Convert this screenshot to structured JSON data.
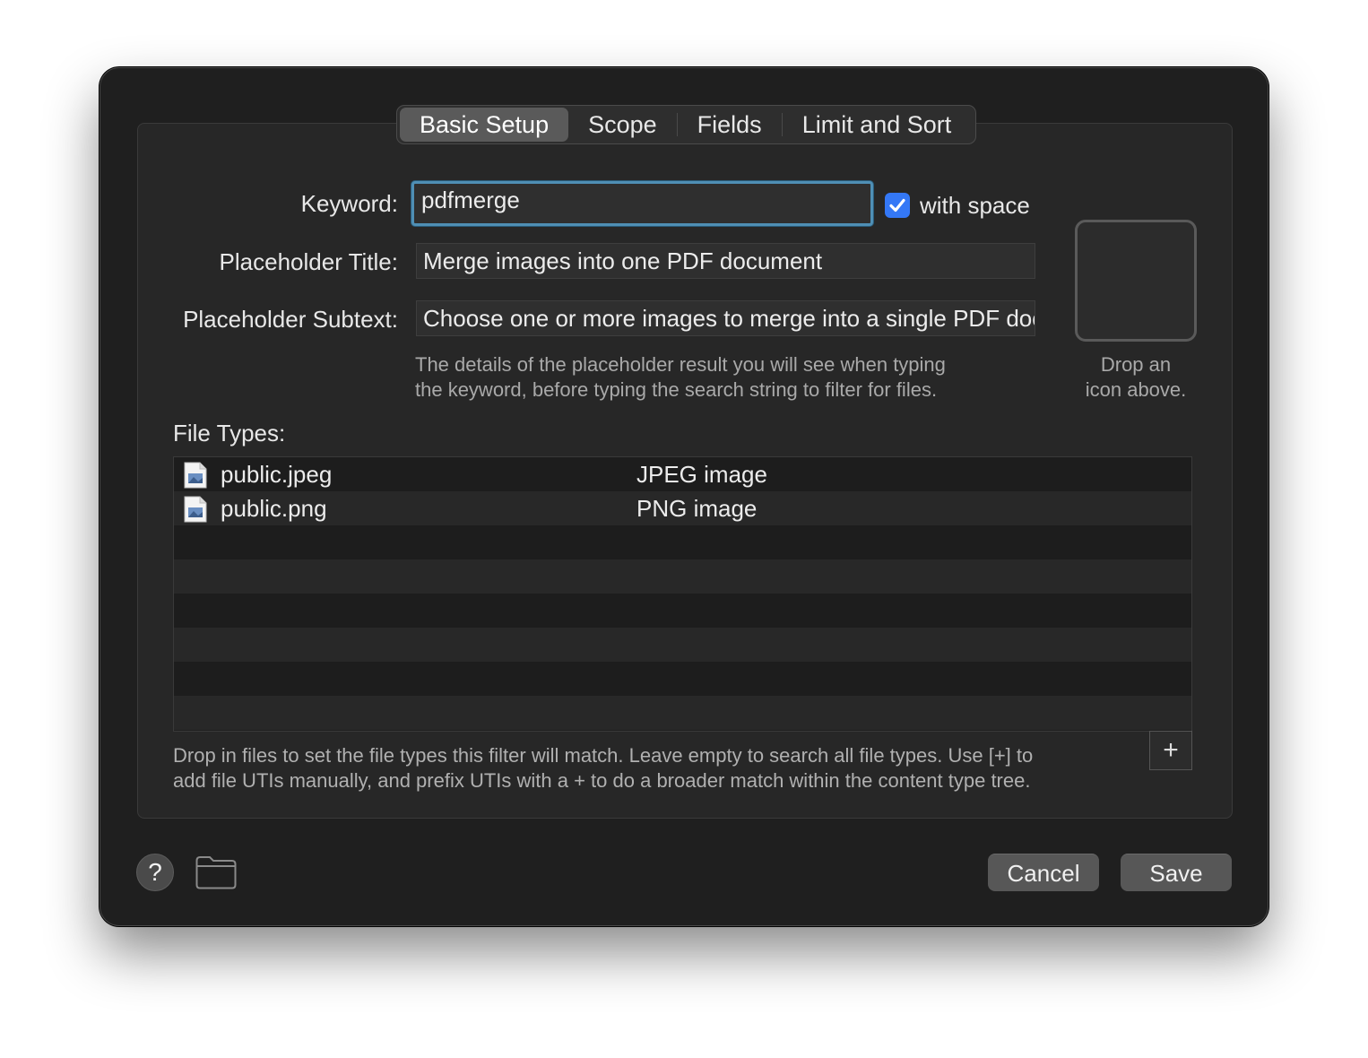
{
  "tabs": [
    {
      "label": "Basic Setup",
      "active": true
    },
    {
      "label": "Scope",
      "active": false
    },
    {
      "label": "Fields",
      "active": false
    },
    {
      "label": "Limit and Sort",
      "active": false
    }
  ],
  "form": {
    "keyword_label": "Keyword:",
    "keyword_value": "pdfmerge",
    "with_space_label": "with space",
    "with_space_checked": true,
    "title_label": "Placeholder Title:",
    "title_value": "Merge images into one PDF document",
    "subtext_label": "Placeholder Subtext:",
    "subtext_value": "Choose one or more images to merge into a single PDF document",
    "hint_line1": "The details of the placeholder result you will see when typing",
    "hint_line2": "the keyword, before typing the search string to filter for files."
  },
  "icon_well": {
    "hint_line1": "Drop an",
    "hint_line2": "icon above."
  },
  "file_types": {
    "label": "File Types:",
    "rows": [
      {
        "uti": "public.jpeg",
        "description": "JPEG image"
      },
      {
        "uti": "public.png",
        "description": "PNG image"
      }
    ],
    "hint_line1": "Drop in files to set the file types this filter will match. Leave empty to search all file types. Use [+] to",
    "hint_line2": "add file UTIs manually, and prefix UTIs with a + to do a broader match within the content type tree.",
    "add_label": "+"
  },
  "footer": {
    "help_label": "?",
    "cancel_label": "Cancel",
    "save_label": "Save"
  },
  "colors": {
    "accent": "#3478f6",
    "focus_ring": "#4f8fb5",
    "window_bg": "#1f1f1f"
  }
}
